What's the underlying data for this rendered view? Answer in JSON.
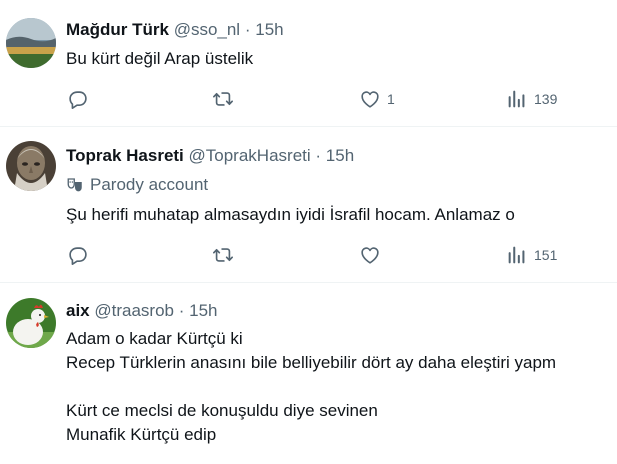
{
  "tweets": [
    {
      "name": "Mağdur Türk",
      "handle": "@sso_nl",
      "separator": "·",
      "time": "15h",
      "text_lines": [
        "Bu kürt değil Arap üstelik"
      ],
      "actions": {
        "reply_count": "",
        "retweet_count": "",
        "like_count": "1",
        "views_count": "139"
      }
    },
    {
      "name": "Toprak Hasreti",
      "handle": "@ToprakHasreti",
      "separator": "·",
      "time": "15h",
      "badge_label": "Parody account",
      "text_lines": [
        "Şu herifi muhatap almasaydın iyidi İsrafil hocam. Anlamaz o"
      ],
      "actions": {
        "reply_count": "",
        "retweet_count": "",
        "like_count": "",
        "views_count": "151"
      }
    },
    {
      "name": "aix",
      "handle": "@traasrob",
      "separator": "·",
      "time": "15h",
      "text_lines": [
        "Adam o kadar Kürtçü ki",
        "Recep Türklerin anasını bile belliyebilir dört ay daha eleştiri yapm",
        "",
        "Kürt ce meclsi de konuşuldu diye sevinen",
        "Munafik Kürtçü edip"
      ]
    }
  ],
  "colors": {
    "text": "#0f1419",
    "secondary": "#536471",
    "divider": "#eff3f4"
  }
}
